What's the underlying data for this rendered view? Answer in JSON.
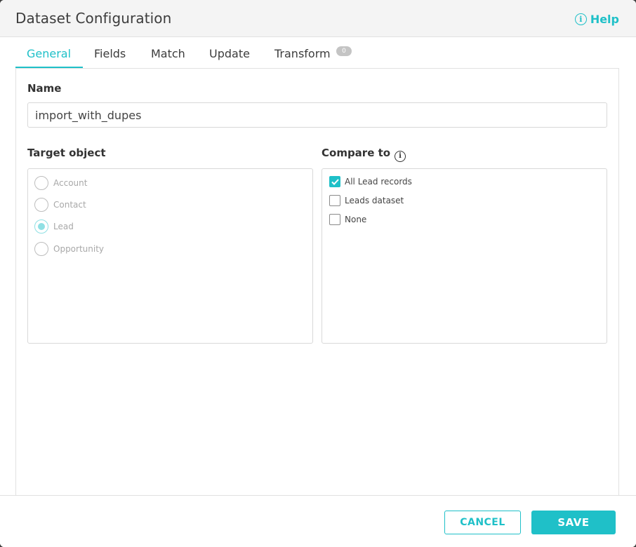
{
  "dialog": {
    "title": "Dataset Configuration",
    "help_label": "Help",
    "help_icon": "info-circle-icon"
  },
  "tabs": [
    {
      "label": "General",
      "active": true
    },
    {
      "label": "Fields",
      "active": false
    },
    {
      "label": "Match",
      "active": false
    },
    {
      "label": "Update",
      "active": false
    },
    {
      "label": "Transform",
      "active": false,
      "badge": "0"
    }
  ],
  "form": {
    "name_label": "Name",
    "name_value": "import_with_dupes",
    "target_label": "Target object",
    "target_options": [
      {
        "label": "Account",
        "selected": false
      },
      {
        "label": "Contact",
        "selected": false
      },
      {
        "label": "Lead",
        "selected": true
      },
      {
        "label": "Opportunity",
        "selected": false
      }
    ],
    "compare_label": "Compare to",
    "compare_options": [
      {
        "label": "All Lead records",
        "checked": true
      },
      {
        "label": "Leads dataset",
        "checked": false
      },
      {
        "label": "None",
        "checked": false
      }
    ]
  },
  "footer": {
    "cancel_label": "CANCEL",
    "save_label": "SAVE"
  },
  "colors": {
    "accent": "#1fc0c8",
    "text": "#3c3c3c"
  }
}
